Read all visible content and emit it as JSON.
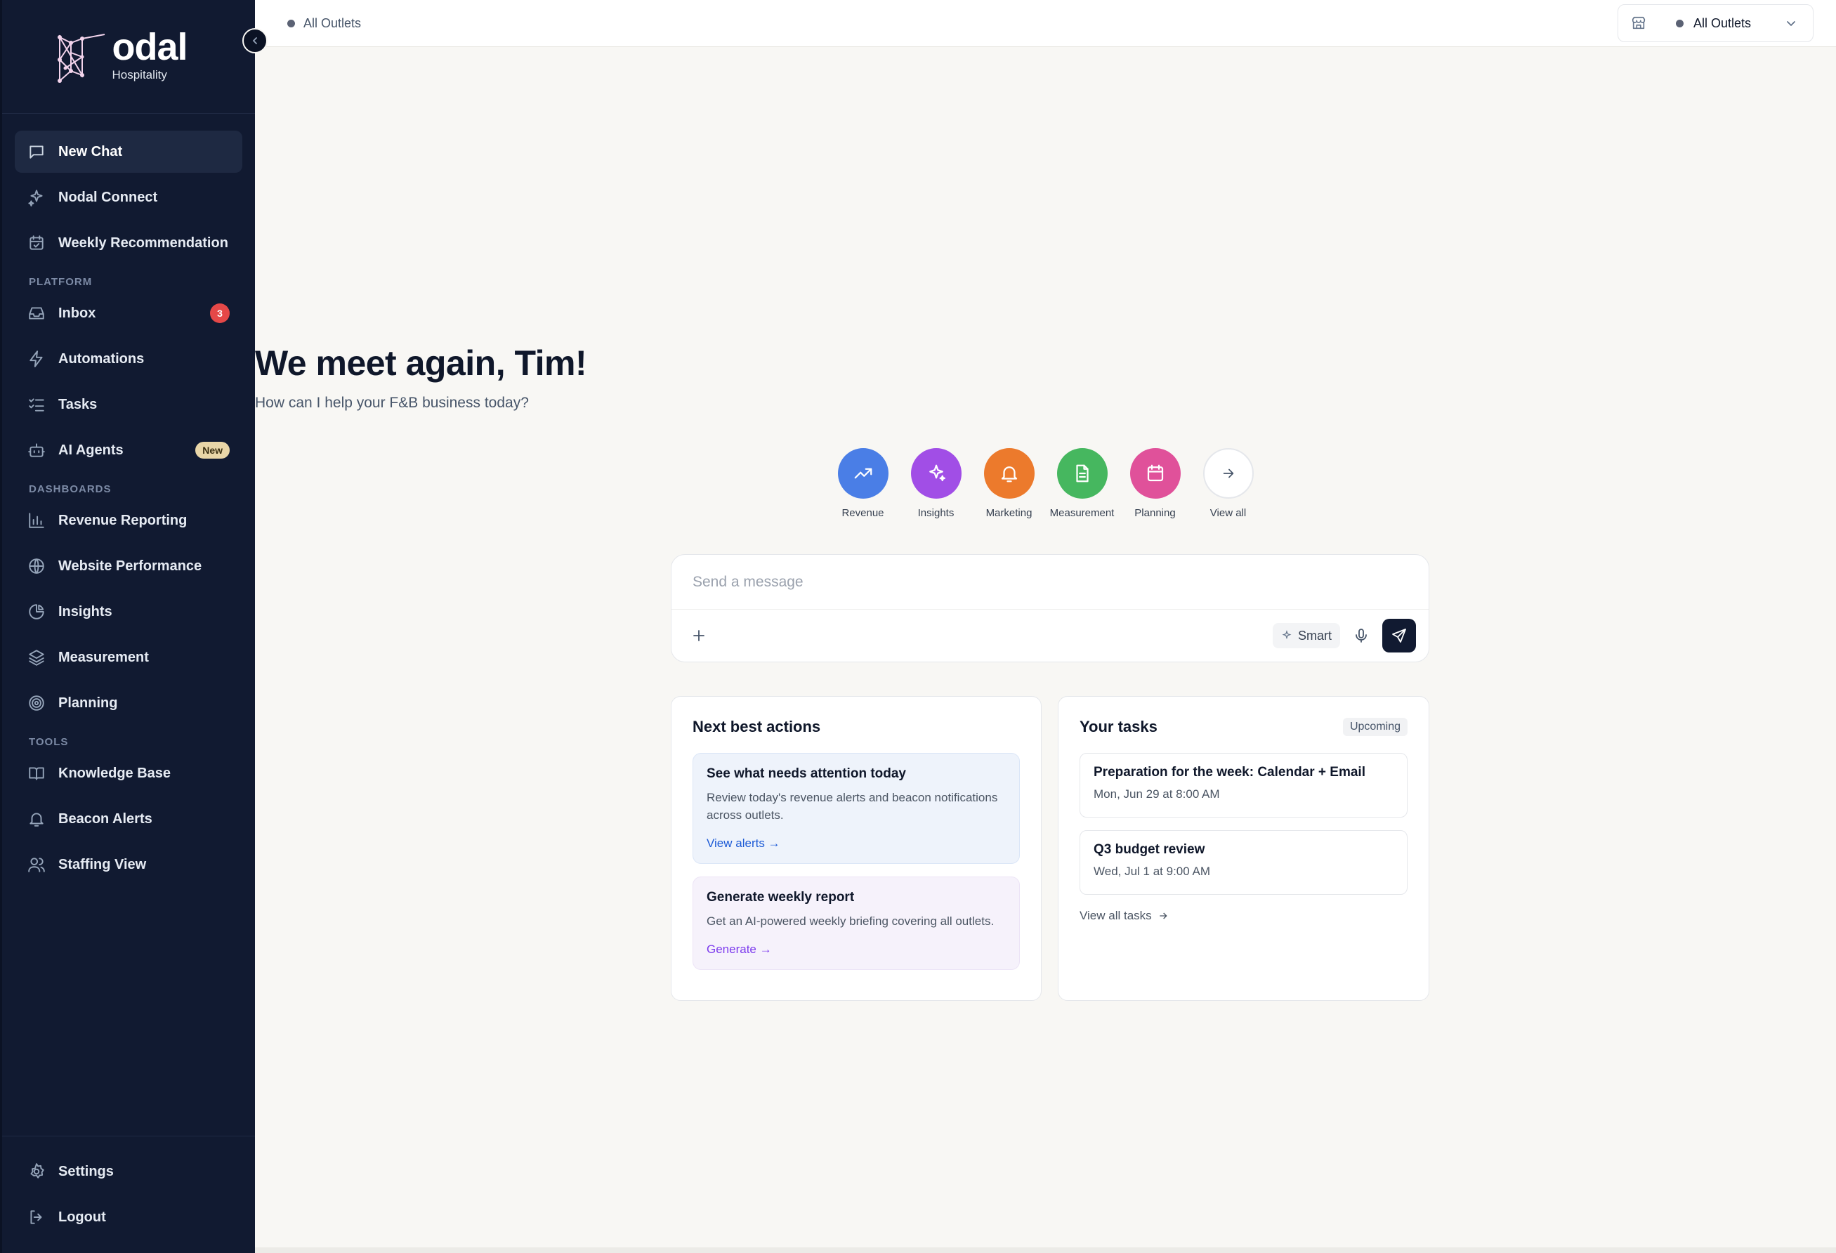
{
  "brand": {
    "name": "odal",
    "sub": "Hospitality"
  },
  "sidebar": {
    "top_items": [
      {
        "label": "New Chat",
        "icon": "message-square-icon"
      },
      {
        "label": "Nodal Connect",
        "icon": "sparkles-icon"
      },
      {
        "label": "Weekly Recommendation",
        "icon": "calendar-check-icon"
      }
    ],
    "platform_label": "PLATFORM",
    "platform_items": [
      {
        "label": "Inbox",
        "icon": "inbox-icon",
        "badge": "3"
      },
      {
        "label": "Automations",
        "icon": "zap-icon"
      },
      {
        "label": "Tasks",
        "icon": "list-checks-icon"
      },
      {
        "label": "AI Agents",
        "icon": "bot-icon",
        "tag": "New"
      }
    ],
    "dashboards_label": "DASHBOARDS",
    "dashboard_items": [
      {
        "label": "Revenue Reporting",
        "icon": "bar-chart-icon"
      },
      {
        "label": "Website Performance",
        "icon": "globe-icon"
      },
      {
        "label": "Insights",
        "icon": "pie-chart-icon"
      },
      {
        "label": "Measurement",
        "icon": "layers-icon"
      },
      {
        "label": "Planning",
        "icon": "target-icon"
      }
    ],
    "tools_label": "TOOLS",
    "tool_items": [
      {
        "label": "Knowledge Base",
        "icon": "book-open-icon"
      },
      {
        "label": "Beacon Alerts",
        "icon": "bell-icon"
      },
      {
        "label": "Staffing View",
        "icon": "users-icon"
      }
    ],
    "bottom_items": [
      {
        "label": "Settings",
        "icon": "gear-icon"
      },
      {
        "label": "Logout",
        "icon": "log-out-icon"
      }
    ]
  },
  "topbar": {
    "breadcrumb": "All Outlets",
    "outlet_selector": "All Outlets"
  },
  "hero": {
    "greeting": "We meet again, Tim!",
    "subtitle": "How can I help your F&B business today?"
  },
  "quick_actions": [
    {
      "label": "Revenue",
      "color": "#4a7ee6",
      "icon": "trending-up-icon"
    },
    {
      "label": "Insights",
      "color": "#a14ee6",
      "icon": "sparkles-icon"
    },
    {
      "label": "Marketing",
      "color": "#ec7a2c",
      "icon": "bell-icon"
    },
    {
      "label": "Measurement",
      "color": "#46b75f",
      "icon": "file-text-icon"
    },
    {
      "label": "Planning",
      "color": "#e0519a",
      "icon": "calendar-icon"
    },
    {
      "label": "View all",
      "color": "#ffffff",
      "icon": "arrow-right-icon"
    }
  ],
  "composer": {
    "placeholder": "Send a message",
    "smart_label": "Smart"
  },
  "next_actions": {
    "title": "Next best actions",
    "items": [
      {
        "title": "See what needs attention today",
        "desc": "Review today's revenue alerts and beacon notifications across outlets.",
        "link": "View alerts →"
      },
      {
        "title": "Generate weekly report",
        "desc": "Get an AI-powered weekly briefing covering all outlets.",
        "link": "Generate →"
      }
    ]
  },
  "tasks": {
    "title": "Your tasks",
    "badge": "Upcoming",
    "items": [
      {
        "title": "Preparation for the week: Calendar + Email",
        "time": "Mon, Jun 29 at 8:00 AM"
      },
      {
        "title": "Q3 budget review",
        "time": "Wed, Jul 1 at 9:00 AM"
      }
    ],
    "view_all": "View all tasks"
  }
}
